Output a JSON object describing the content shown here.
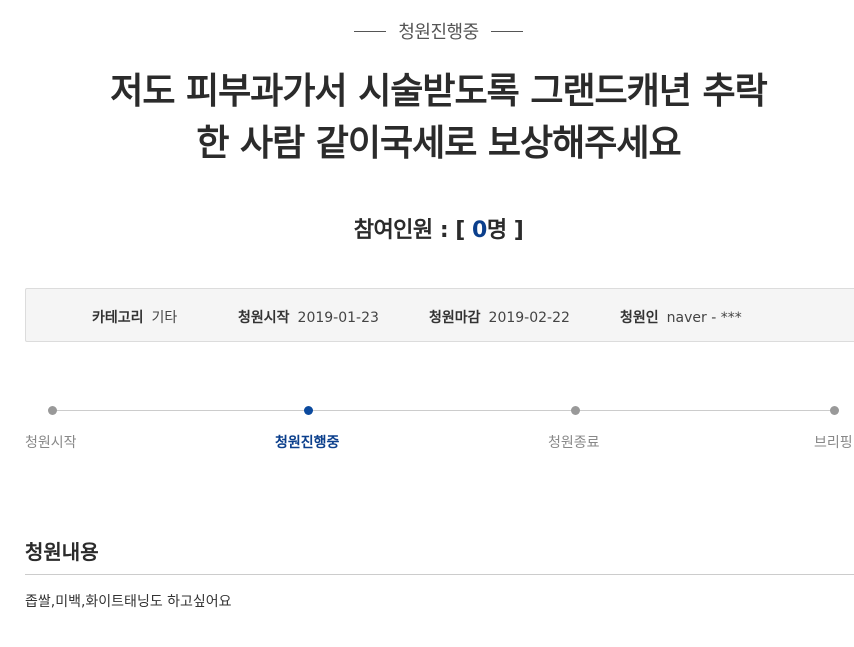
{
  "status": {
    "label": "청원진행중"
  },
  "title": {
    "line1": "저도 피부과가서 시술받도록 그랜드캐년 추락",
    "line2": "한 사람 같이국세로 보상해주세요"
  },
  "participants": {
    "prefix": "참여인원 : [ ",
    "count": "0",
    "suffix": "명 ]"
  },
  "meta": {
    "category_label": "카테고리",
    "category_value": "기타",
    "start_label": "청원시작",
    "start_value": "2019-01-23",
    "end_label": "청원마감",
    "end_value": "2019-02-22",
    "author_label": "청원인",
    "author_value": "naver - ***"
  },
  "steps": [
    {
      "label": "청원시작",
      "active": false
    },
    {
      "label": "청원진행중",
      "active": true
    },
    {
      "label": "청원종료",
      "active": false
    },
    {
      "label": "브리핑",
      "active": false
    }
  ],
  "content": {
    "heading": "청원내용",
    "body": "좁쌀,미백,화이트태닝도 하고싶어요"
  },
  "colors": {
    "accent": "#0b3f8c",
    "inactive_dot": "#999999",
    "meta_bg": "#f5f5f5"
  }
}
